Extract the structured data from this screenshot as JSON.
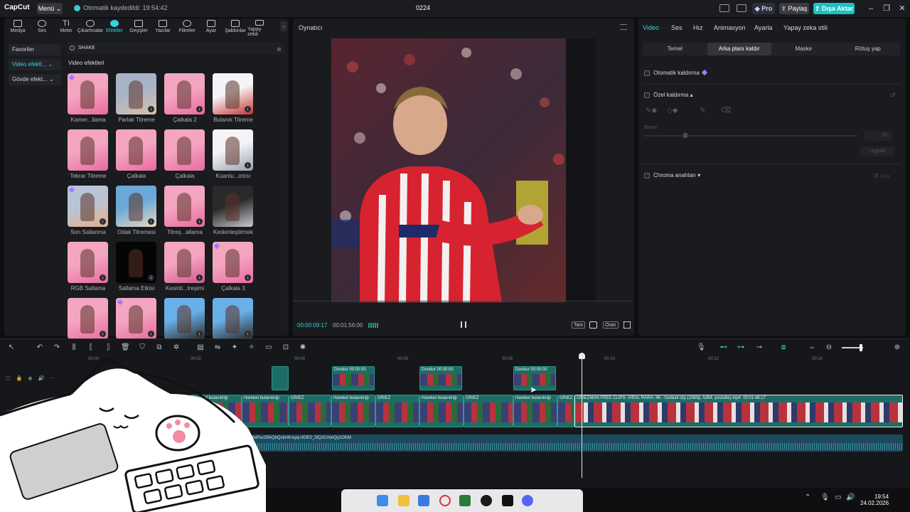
{
  "titlebar": {
    "logo": "CapCut",
    "menu": "Menü",
    "autosave": "Otomatik kaydedildi: 19:54:42",
    "project": "0224",
    "pro": "Pro",
    "share": "Paylaş",
    "export": "Dışa Aktar"
  },
  "tools": [
    {
      "label": "Medya",
      "icon": "media-icon"
    },
    {
      "label": "Ses",
      "icon": "audio-icon"
    },
    {
      "label": "Metin",
      "icon": "text-icon"
    },
    {
      "label": "Çıkartmalar",
      "icon": "sticker-icon"
    },
    {
      "label": "Efektler",
      "icon": "effects-icon"
    },
    {
      "label": "Geçişler",
      "icon": "transition-icon"
    },
    {
      "label": "Yazılar",
      "icon": "captions-icon"
    },
    {
      "label": "Filtreler",
      "icon": "filter-icon"
    },
    {
      "label": "Ayar",
      "icon": "adjust-icon"
    },
    {
      "label": "Şablonlar",
      "icon": "template-icon"
    },
    {
      "label": "Yapay zekâ",
      "icon": "ai-icon"
    }
  ],
  "categories": {
    "favorites": "Favoriler",
    "video_effects": "Video efektl...",
    "body_effects": "Gövde efekt..."
  },
  "search": {
    "value": "SHAKE"
  },
  "section_title": "Video efektleri",
  "effects": [
    {
      "label": "Kamer...llama"
    },
    {
      "label": "Parlak Titreme"
    },
    {
      "label": "Çalkala 2"
    },
    {
      "label": "Bulanık Titreme"
    },
    {
      "label": "Tekrar Titreme"
    },
    {
      "label": "Çalkala"
    },
    {
      "label": "Çalkala"
    },
    {
      "label": "Kuantu...intısı"
    },
    {
      "label": "Son Sallanma"
    },
    {
      "label": "Odak Titremesi"
    },
    {
      "label": "Titreş...allama"
    },
    {
      "label": "Keskinleştirmek"
    },
    {
      "label": "RGB Sallama"
    },
    {
      "label": "Sallama Etkisi"
    },
    {
      "label": "Kesinti...treşimi"
    },
    {
      "label": "Çalkala 3"
    }
  ],
  "preview": {
    "title": "Oynatıcı",
    "current_time": "00:00:09:17",
    "total_time": "00:01:56:00",
    "full_label": "Tam",
    "ratio_label": "Oran"
  },
  "inspector": {
    "tabs": [
      "Video",
      "Ses",
      "Hız",
      "Animasyon",
      "Ayarla",
      "Yapay zeka stili"
    ],
    "subtabs": [
      "Temel",
      "Arka planı kaldır",
      "Maske",
      "Rötuş yap"
    ],
    "auto_remove": "Otomatik kaldırma",
    "custom_remove": "Özel kaldırma",
    "size_label": "Boyut",
    "size_value": "20",
    "apply": "Uygula",
    "chroma": "Chroma anahtarı"
  },
  "timeline": {
    "ruler": [
      "00:00",
      "00:02",
      "00:04",
      "00:06",
      "00:08",
      "00:10",
      "00:12",
      "00:14"
    ],
    "clip_hareket": "Hareket bulanıklığı",
    "clip_griez": "GRIEZ",
    "clip_main": "GRIEZMAN FREE CLIPS- VIRAL RARA- 4K - football clip (1080p, h264, youtube).mp4",
    "clip_main_dur": "00:01:46:17",
    "clip_donder": "Dondur",
    "clip_donder_dur": "00:00:00",
    "audio": "E8WuTT7424PWn7OtePuc39AQbQxbrW-eyq-cfOE0_3IQ2CminQy1OKM"
  },
  "taskbar": {
    "time": "19:54",
    "date": "24.02.2026"
  }
}
